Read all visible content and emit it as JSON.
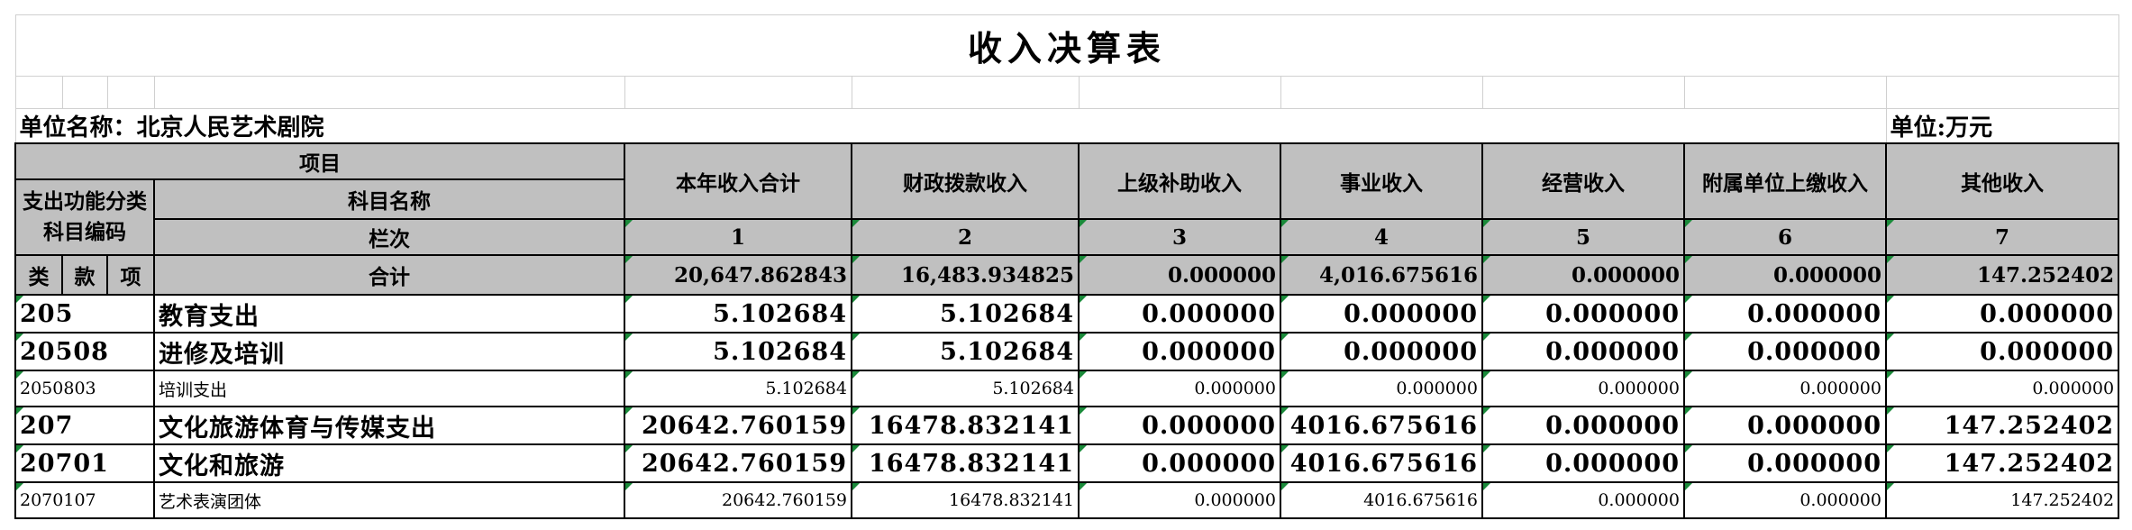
{
  "title": "收入决算表",
  "unit_name_label": "单位名称：北京人民艺术剧院",
  "unit_label": "单位:万元",
  "header": {
    "project": "项目",
    "func_code": "支出功能分类科目编码",
    "subject_name": "科目名称",
    "column_no": "栏次",
    "lei": "类",
    "kuan": "款",
    "xiang": "项",
    "total_label": "合计",
    "columns": [
      "本年收入合计",
      "财政拨款收入",
      "上级补助收入",
      "事业收入",
      "经营收入",
      "附属单位上缴收入",
      "其他收入"
    ],
    "column_numbers": [
      "1",
      "2",
      "3",
      "4",
      "5",
      "6",
      "7"
    ]
  },
  "totals": [
    "20,647.862843",
    "16,483.934825",
    "0.000000",
    "4,016.675616",
    "0.000000",
    "0.000000",
    "147.252402"
  ],
  "rows": [
    {
      "code": "205",
      "name": "教育支出",
      "values": [
        "5.102684",
        "5.102684",
        "0.000000",
        "0.000000",
        "0.000000",
        "0.000000",
        "0.000000"
      ]
    },
    {
      "code": "20508",
      "name": "进修及培训",
      "values": [
        "5.102684",
        "5.102684",
        "0.000000",
        "0.000000",
        "0.000000",
        "0.000000",
        "0.000000"
      ]
    },
    {
      "code": "2050803",
      "name": "培训支出",
      "values": [
        "5.102684",
        "5.102684",
        "0.000000",
        "0.000000",
        "0.000000",
        "0.000000",
        "0.000000"
      ]
    },
    {
      "code": "207",
      "name": "文化旅游体育与传媒支出",
      "values": [
        "20642.760159",
        "16478.832141",
        "0.000000",
        "4016.675616",
        "0.000000",
        "0.000000",
        "147.252402"
      ]
    },
    {
      "code": "20701",
      "name": "文化和旅游",
      "values": [
        "20642.760159",
        "16478.832141",
        "0.000000",
        "4016.675616",
        "0.000000",
        "0.000000",
        "147.252402"
      ]
    },
    {
      "code": "2070107",
      "name": "艺术表演团体",
      "values": [
        "20642.760159",
        "16478.832141",
        "0.000000",
        "4016.675616",
        "0.000000",
        "0.000000",
        "147.252402"
      ]
    }
  ]
}
